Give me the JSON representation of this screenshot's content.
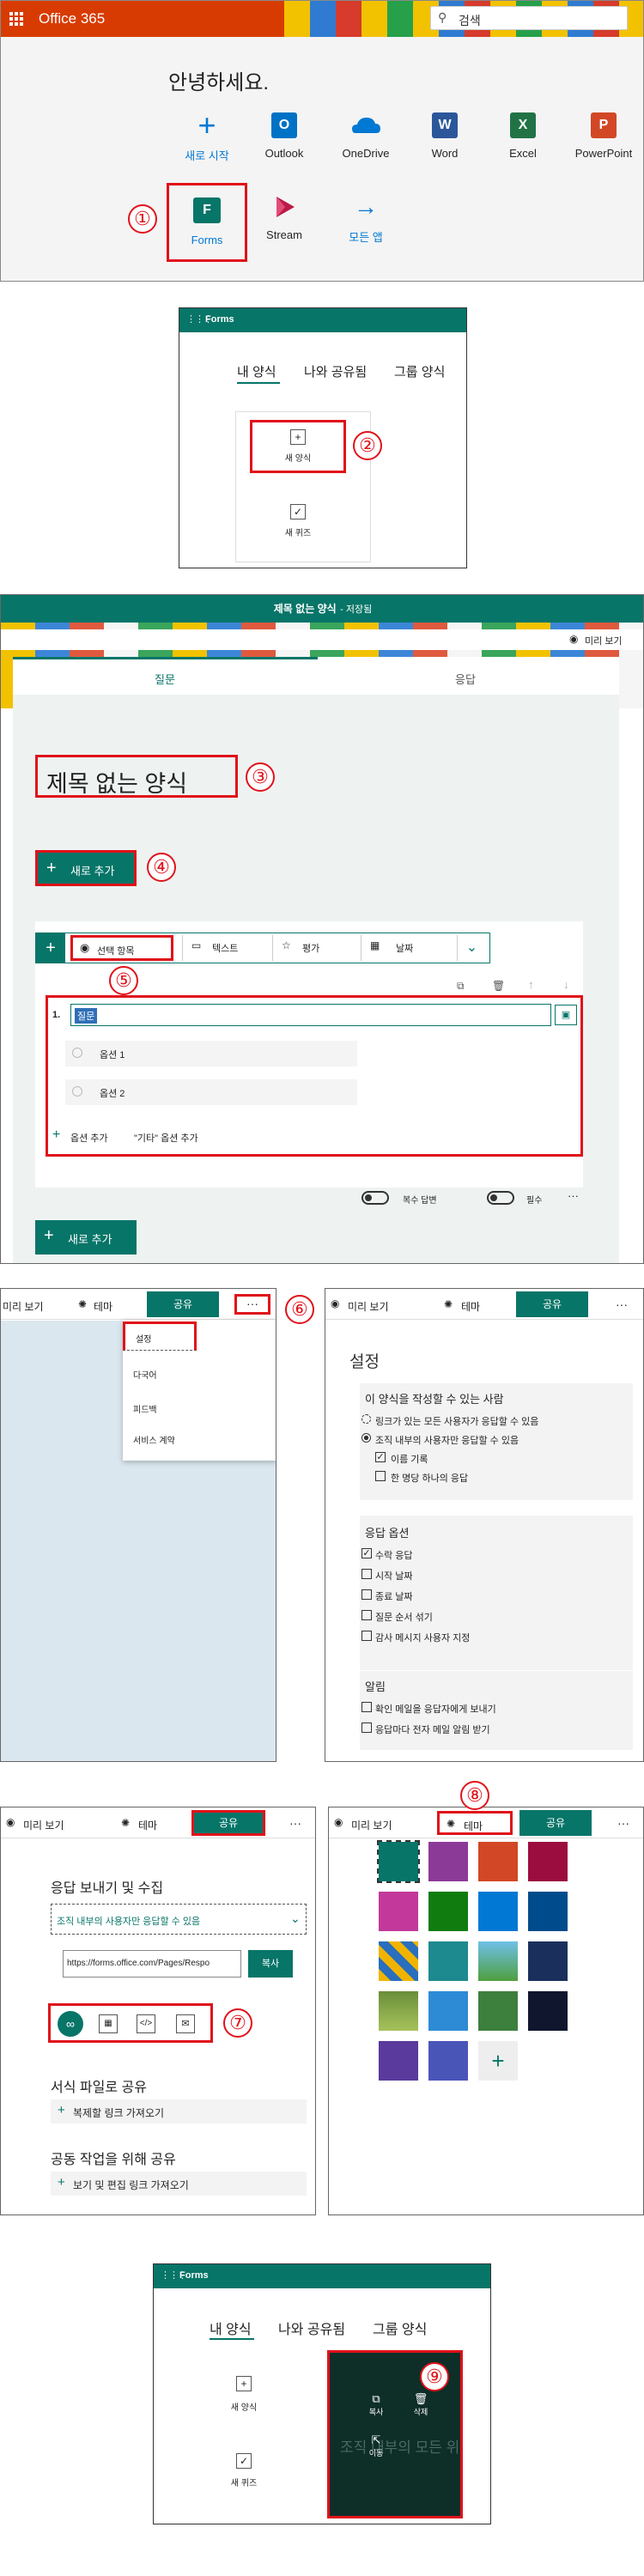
{
  "s1": {
    "brand": "Office 365",
    "search_placeholder": "검색",
    "greeting": "안녕하세요.",
    "apps": [
      {
        "label": "새로 시작",
        "icon": "plus-icon"
      },
      {
        "label": "Outlook",
        "icon": "outlook-icon"
      },
      {
        "label": "OneDrive",
        "icon": "onedrive-icon"
      },
      {
        "label": "Word",
        "icon": "word-icon"
      },
      {
        "label": "Excel",
        "icon": "excel-icon"
      },
      {
        "label": "PowerPoint",
        "icon": "powerpoint-icon"
      },
      {
        "label": "Forms",
        "icon": "forms-icon"
      },
      {
        "label": "Stream",
        "icon": "stream-icon"
      },
      {
        "label": "모든 앱",
        "icon": "arrow-right-icon"
      }
    ],
    "marker": "①"
  },
  "s2": {
    "app": "Forms",
    "tabs": [
      "내 양식",
      "나와 공유됨",
      "그룹 양식"
    ],
    "new_form": "새 양식",
    "new_quiz": "새 퀴즈",
    "marker": "②"
  },
  "s3": {
    "header": "제목 없는 양식",
    "saved": "- 저장됨",
    "preview": "미리 보기",
    "tabs": [
      "질문",
      "응답"
    ],
    "title": "제목 없는 양식",
    "add_new": "새로 추가",
    "types": [
      "선택 항목",
      "텍스트",
      "평가",
      "날짜"
    ],
    "q_num": "1.",
    "q_value": "질문",
    "options": [
      "옵션 1",
      "옵션 2"
    ],
    "add_option": "옵션 추가",
    "add_other": "\"기타\" 옵션 추가",
    "multi": "복수 답변",
    "required": "필수",
    "more": "···",
    "markers": [
      "③",
      "④",
      "⑤"
    ]
  },
  "s4": {
    "preview": "미리 보기",
    "theme": "테마",
    "share": "공유",
    "more": "···",
    "menu": [
      "설정",
      "다국어",
      "피드백",
      "서비스 계약"
    ],
    "marker": "⑥"
  },
  "s5": {
    "preview": "미리 보기",
    "theme": "테마",
    "share": "공유",
    "more": "···",
    "title": "설정",
    "who_title": "이 양식을 작성할 수 있는 사람",
    "who": [
      "링크가 있는 모든 사용자가 응답할 수 있음",
      "조직 내부의 사용자만 응답할 수 있음",
      "이름 기록",
      "한 명당 하나의 응답"
    ],
    "resp_title": "응답 옵션",
    "resp": [
      "수락 응답",
      "시작 날짜",
      "종료 날짜",
      "질문 순서 섞기",
      "감사 메시지 사용자 지정"
    ],
    "notif_title": "알림",
    "notif": [
      "확인 메일을 응답자에게 보내기",
      "응답마다 전자 메일 알림 받기"
    ]
  },
  "s6": {
    "preview": "미리 보기",
    "theme": "테마",
    "share": "공유",
    "more": "···",
    "title": "응답 보내기 및 수집",
    "dropdown": "조직 내부의 사용자만 응답할 수 있음",
    "url": "https://forms.office.com/Pages/Respo",
    "copy": "복사",
    "template_title": "서식 파일로 공유",
    "template_link": "복제할 링크 가져오기",
    "collab_title": "공동 작업을 위해 공유",
    "collab_link": "보기 및 편집 링크 가져오기",
    "marker": "⑦"
  },
  "s7": {
    "preview": "미리 보기",
    "theme": "테마",
    "share": "공유",
    "more": "···",
    "swatches": [
      "#077568",
      "#8b3a97",
      "#d24726",
      "#9a0d3e",
      "#c2399b",
      "#107c10",
      "#0078d4",
      "#004b8b"
    ],
    "marker": "⑧"
  },
  "s8": {
    "app": "Forms",
    "tabs": [
      "내 양식",
      "나와 공유됨",
      "그룹 양식"
    ],
    "new_form": "새 양식",
    "new_quiz": "새 퀴즈",
    "copy": "복사",
    "delete": "삭제",
    "move": "이동",
    "card_text": "조직 내부의 모든 위",
    "marker": "⑨"
  }
}
